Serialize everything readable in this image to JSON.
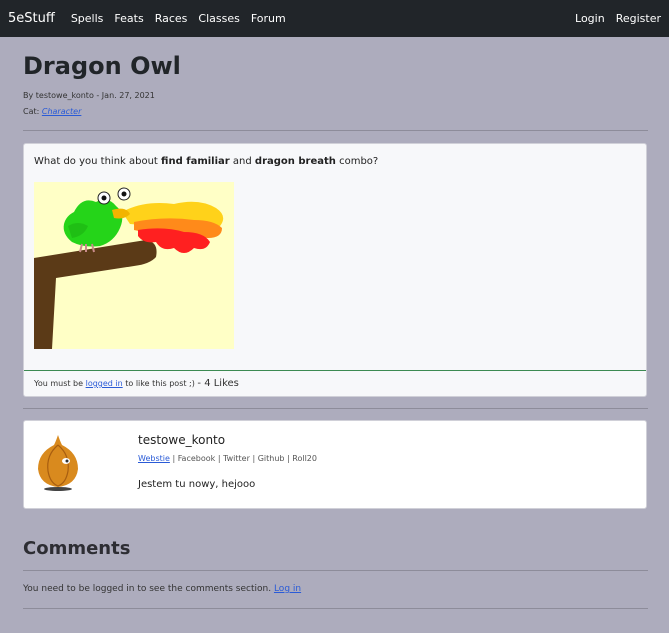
{
  "nav": {
    "brand": "5eStuff",
    "links": [
      "Spells",
      "Feats",
      "Races",
      "Classes",
      "Forum"
    ],
    "right": [
      "Login",
      "Register"
    ]
  },
  "post": {
    "title": "Dragon Owl",
    "byline": "By testowe_konto - Jan. 27, 2021",
    "cat_label": "Cat:",
    "category": "Character",
    "question": {
      "prefix": "What do you think about",
      "term1": "find familiar",
      "mid": "and",
      "term2": "dragon breath",
      "suffix": "combo?"
    },
    "footer": {
      "prefix": "You must be",
      "link": "logged in",
      "suffix": "to like this post ;)",
      "likes": "- 4 Likes"
    }
  },
  "author": {
    "name": "testowe_konto",
    "links": [
      "Webstie",
      "Facebook",
      "Twitter",
      "Github",
      "Roll20"
    ],
    "separator": "|",
    "bio": "Jestem tu nowy, hejooo"
  },
  "comments": {
    "title": "Comments",
    "notice": "You need to be logged in to see the comments section.",
    "login_link": "Log in"
  }
}
